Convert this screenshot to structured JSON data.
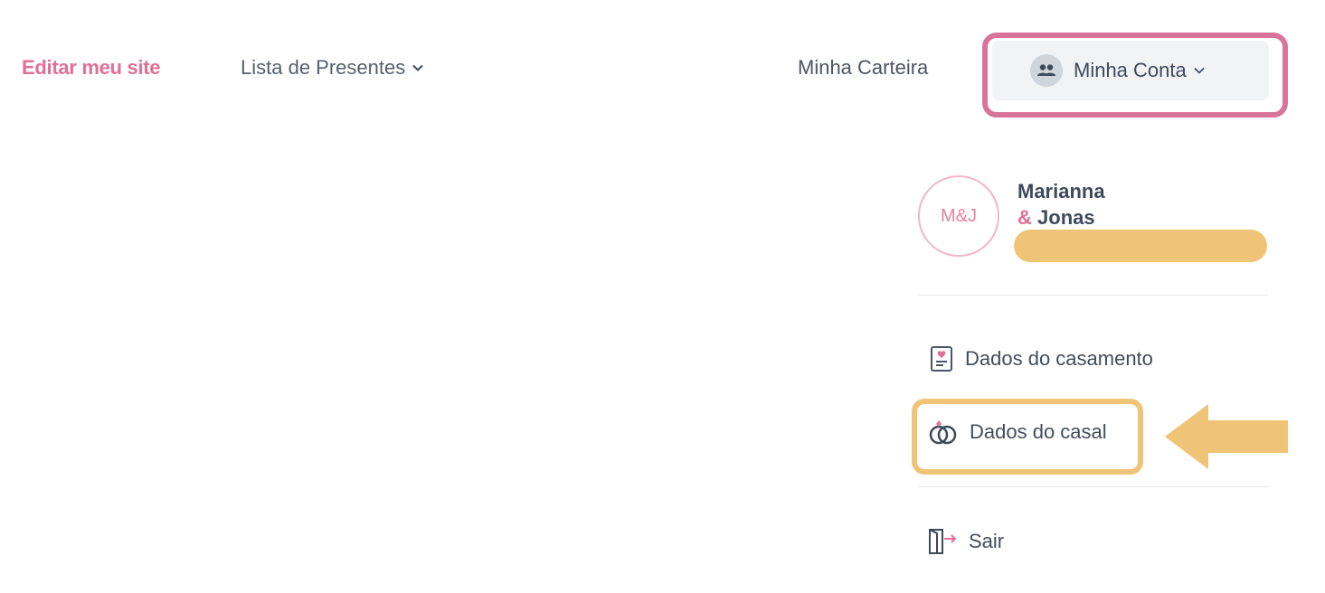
{
  "nav": {
    "edit_site": "Editar meu site",
    "gift_list": "Lista de Presentes",
    "wallet": "Minha Carteira",
    "account": "Minha Conta"
  },
  "profile": {
    "monogram": "M&J",
    "name_line1": "Marianna",
    "name_line2_amp": "&",
    "name_line2": "Jonas"
  },
  "menu": {
    "wedding_data": "Dados do casamento",
    "couple_data": "Dados do casal",
    "exit": "Sair"
  },
  "icons": {
    "gift_list_chevron": "chevron-down-icon",
    "account": "people-icon",
    "account_chevron": "chevron-down-icon",
    "wedding_data": "document-heart-icon",
    "couple_data": "rings-icon",
    "exit": "door-exit-icon"
  },
  "colors": {
    "brand_pink": "#e26f95",
    "account_highlight": "#d8749a",
    "annotation_yellow": "#f0c476"
  }
}
